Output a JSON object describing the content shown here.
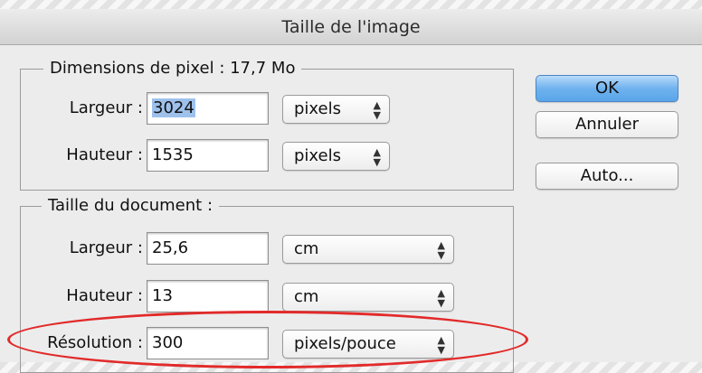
{
  "window": {
    "title": "Taille de l'image"
  },
  "pixel_dimensions": {
    "legend": "Dimensions de pixel :  17,7 Mo",
    "width": {
      "label": "Largeur :",
      "value": "3024",
      "unit": "pixels"
    },
    "height": {
      "label": "Hauteur :",
      "value": "1535",
      "unit": "pixels"
    }
  },
  "document_size": {
    "legend": "Taille du document :",
    "width": {
      "label": "Largeur :",
      "value": "25,6",
      "unit": "cm"
    },
    "height": {
      "label": "Hauteur :",
      "value": "13",
      "unit": "cm"
    },
    "resolution": {
      "label": "Résolution :",
      "value": "300",
      "unit": "pixels/pouce"
    }
  },
  "buttons": {
    "ok": "OK",
    "cancel": "Annuler",
    "auto": "Auto..."
  },
  "annotation": {
    "color": "#e22a2a",
    "shape": "ellipse around Résolution row"
  },
  "icons": {
    "popup_arrows": "up-down-arrows-icon"
  },
  "colors": {
    "default_button": "#6fb2ee",
    "selection": "#9ec1ec"
  }
}
